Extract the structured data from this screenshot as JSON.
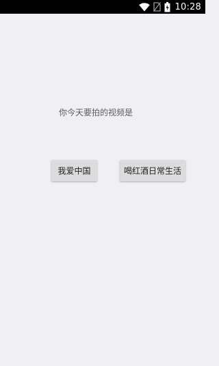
{
  "status_bar": {
    "time": "10:28",
    "icons": [
      "wifi-icon",
      "no-sim-icon",
      "battery-icon"
    ],
    "background": "#000000"
  },
  "main": {
    "prompt": "你今天要拍的视频是",
    "buttons": [
      {
        "label": "我爱中国"
      },
      {
        "label": "喝红酒日常生活"
      }
    ],
    "background": "#efeff4",
    "button_color": "#dcdcdc"
  }
}
